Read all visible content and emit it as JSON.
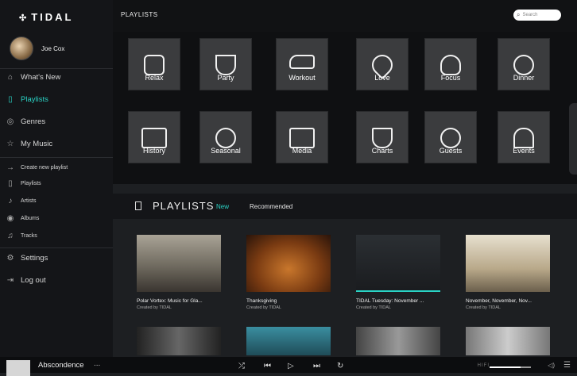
{
  "logo": "TIDAL",
  "user": {
    "name": "Joe Cox"
  },
  "nav_main": [
    {
      "label": "What's New",
      "icon": "home-icon"
    },
    {
      "label": "Playlists",
      "icon": "playlist-icon"
    },
    {
      "label": "Genres",
      "icon": "genre-icon"
    },
    {
      "label": "My Music",
      "icon": "star-icon"
    }
  ],
  "nav_mymusic": [
    {
      "label": "Create new playlist",
      "icon": "arrow-right-icon"
    },
    {
      "label": "Playlists",
      "icon": "playlist-icon"
    },
    {
      "label": "Artists",
      "icon": "guitar-icon"
    },
    {
      "label": "Albums",
      "icon": "album-icon"
    },
    {
      "label": "Tracks",
      "icon": "note-icon"
    }
  ],
  "nav_footer": [
    {
      "label": "Settings",
      "icon": "settings-icon"
    },
    {
      "label": "Log out",
      "icon": "logout-icon"
    }
  ],
  "topbar": {
    "title": "PLAYLISTS",
    "search_placeholder": "Search"
  },
  "genres": [
    "Relax",
    "Party",
    "Workout",
    "Love",
    "Focus",
    "Dinner",
    "History",
    "Seasonal",
    "Media",
    "Charts",
    "Guests",
    "Events"
  ],
  "section": {
    "title": "PLAYLISTS",
    "tab_new": "New",
    "tab_recommended": "Recommended"
  },
  "cards": [
    {
      "title": "Polar Vortex: Music for Gla...",
      "sub": "Created by TIDAL"
    },
    {
      "title": "Thanksgiving",
      "sub": "Created by TIDAL"
    },
    {
      "title": "TIDAL Tuesday: November ...",
      "sub": "Created by TIDAL"
    },
    {
      "title": "November, November, Nov...",
      "sub": "Created by TIDAL"
    }
  ],
  "player": {
    "track": "Abscondence",
    "more": "...",
    "hifi": "HIFI",
    "volume": 0.75
  },
  "colors": {
    "accent": "#2ad3c5"
  }
}
